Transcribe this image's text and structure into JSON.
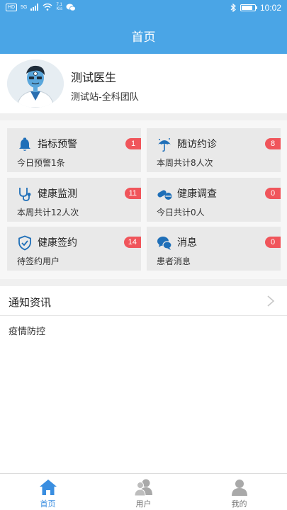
{
  "status_bar": {
    "network": "HD",
    "signal": "5G",
    "speed_top": "7.1",
    "speed_bottom": "K/s",
    "time": "10:02",
    "battery_level": 0.85
  },
  "header": {
    "title": "首页"
  },
  "profile": {
    "name": "测试医生",
    "team": "测试站-全科团队"
  },
  "cards": [
    {
      "title": "指标预警",
      "subtitle": "今日预警1条",
      "badge": "1",
      "icon": "bell-icon"
    },
    {
      "title": "随访约诊",
      "subtitle": "本周共计8人次",
      "badge": "8",
      "icon": "umbrella-icon"
    },
    {
      "title": "健康监测",
      "subtitle": "本周共计12人次",
      "badge": "11",
      "icon": "stethoscope-icon"
    },
    {
      "title": "健康调查",
      "subtitle": "今日共计0人",
      "badge": "0",
      "icon": "pill-icon"
    },
    {
      "title": "健康签约",
      "subtitle": "待签约用户",
      "badge": "14",
      "icon": "shield-check-icon"
    },
    {
      "title": "消息",
      "subtitle": "患者消息",
      "badge": "0",
      "icon": "chat-icon"
    }
  ],
  "news": {
    "title": "通知资讯",
    "items": [
      "疫情防控"
    ]
  },
  "tabbar": {
    "tabs": [
      {
        "label": "首页",
        "icon": "home-icon",
        "active": true
      },
      {
        "label": "用户",
        "icon": "users-icon",
        "active": false
      },
      {
        "label": "我的",
        "icon": "person-icon",
        "active": false
      }
    ]
  },
  "colors": {
    "primary": "#4aa5e6",
    "icon_blue": "#1f6fb8",
    "badge": "#f0555b",
    "tab_active": "#3a8ee0",
    "tab_inactive": "#9a9a9a"
  }
}
